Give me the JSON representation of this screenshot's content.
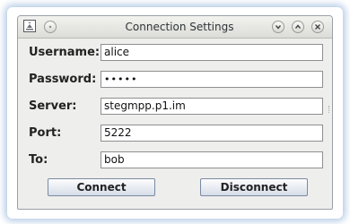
{
  "window": {
    "title": "Connection Settings"
  },
  "form": {
    "username": {
      "label": "Username:",
      "value": "alice"
    },
    "password": {
      "label": "Password:",
      "value": "•••••"
    },
    "server": {
      "label": "Server:",
      "value": "stegmpp.p1.im"
    },
    "port": {
      "label": "Port:",
      "value": "5222"
    },
    "to": {
      "label": "To:",
      "value": "bob"
    }
  },
  "buttons": {
    "connect": "Connect",
    "disconnect": "Disconnect"
  },
  "icons": {
    "app": "java-app-icon",
    "menu": "window-menu-icon",
    "minimize": "minimize-icon",
    "maximize": "maximize-icon",
    "close": "close-icon"
  }
}
